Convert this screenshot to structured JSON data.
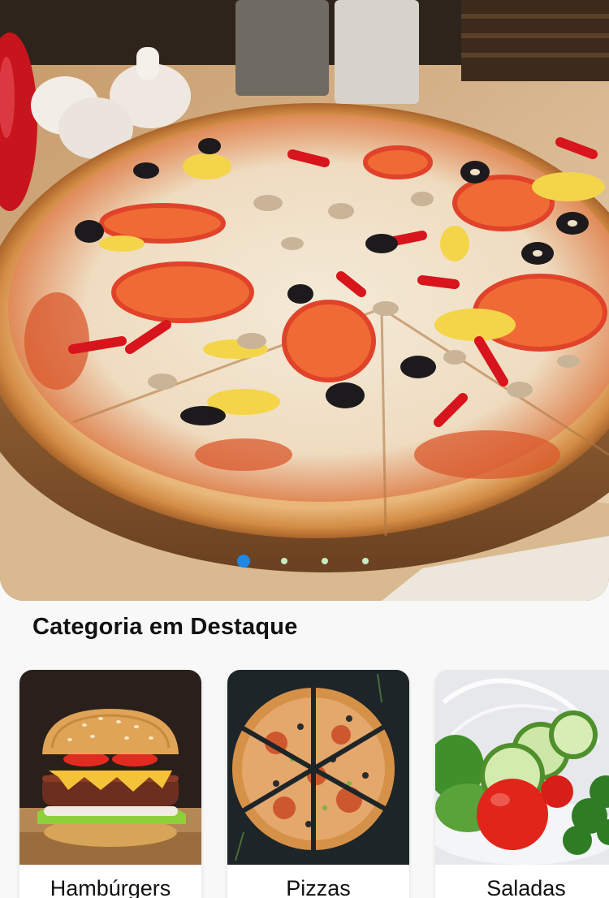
{
  "carousel": {
    "slide_count": 4,
    "active_index": 0,
    "colors": {
      "active_dot": "#1e88e5",
      "inactive_dot": "#c7ecc4"
    }
  },
  "featured": {
    "title": "Categoria em Destaque",
    "categories": [
      {
        "label": "Hambúrgers",
        "icon": "burger-image"
      },
      {
        "label": "Pizzas",
        "icon": "pizza-image"
      },
      {
        "label": "Saladas",
        "icon": "salad-image"
      }
    ]
  }
}
